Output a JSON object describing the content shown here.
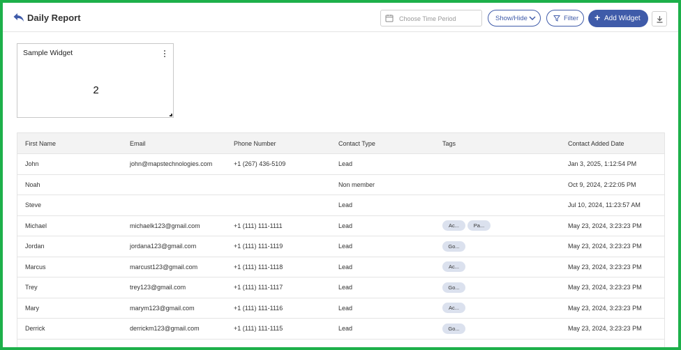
{
  "header": {
    "title": "Daily Report",
    "time_period_placeholder": "Choose Time Period",
    "show_hide_label": "Show/Hide",
    "filter_label": "Filter",
    "add_widget_label": "Add Widget"
  },
  "widget": {
    "title": "Sample Widget",
    "value": "2"
  },
  "table": {
    "columns": [
      "First Name",
      "Email",
      "Phone Number",
      "Contact Type",
      "Tags",
      "Contact Added Date"
    ],
    "rows": [
      {
        "first_name": "John",
        "email": "john@mapstechnologies.com",
        "phone": "+1 (267) 436-5109",
        "type": "Lead",
        "tags": [],
        "date": "Jan 3, 2025, 1:12:54 PM"
      },
      {
        "first_name": "Noah",
        "email": "",
        "phone": "",
        "type": "Non member",
        "tags": [],
        "date": "Oct 9, 2024, 2:22:05 PM"
      },
      {
        "first_name": "Steve",
        "email": "",
        "phone": "",
        "type": "Lead",
        "tags": [],
        "date": "Jul 10, 2024, 11:23:57 AM"
      },
      {
        "first_name": "Michael",
        "email": "michaelk123@gmail.com",
        "phone": "+1 (111) 111-1111",
        "type": "Lead",
        "tags": [
          "Ac...",
          "Pa..."
        ],
        "date": "May 23, 2024, 3:23:23 PM"
      },
      {
        "first_name": "Jordan",
        "email": "jordana123@gmail.com",
        "phone": "+1 (111) 111-1119",
        "type": "Lead",
        "tags": [
          "Go..."
        ],
        "date": "May 23, 2024, 3:23:23 PM"
      },
      {
        "first_name": "Marcus",
        "email": "marcust123@gmail.com",
        "phone": "+1 (111) 111-1118",
        "type": "Lead",
        "tags": [
          "Ac..."
        ],
        "date": "May 23, 2024, 3:23:23 PM"
      },
      {
        "first_name": "Trey",
        "email": "trey123@gmail.com",
        "phone": "+1 (111) 111-1117",
        "type": "Lead",
        "tags": [
          "Go..."
        ],
        "date": "May 23, 2024, 3:23:23 PM"
      },
      {
        "first_name": "Mary",
        "email": "marym123@gmail.com",
        "phone": "+1 (111) 111-1116",
        "type": "Lead",
        "tags": [
          "Ac..."
        ],
        "date": "May 23, 2024, 3:23:23 PM"
      },
      {
        "first_name": "Derrick",
        "email": "derrickm123@gmail.com",
        "phone": "+1 (111) 111-1115",
        "type": "Lead",
        "tags": [
          "Go..."
        ],
        "date": "May 23, 2024, 3:23:23 PM"
      }
    ]
  },
  "icons": {
    "back": "back-arrow-icon",
    "calendar": "calendar-icon",
    "chevron": "chevron-down-icon",
    "filter": "filter-icon",
    "plus": "plus-icon",
    "download": "download-icon",
    "kebab": "more-vertical-icon",
    "resize": "resize-handle-icon"
  },
  "colors": {
    "accent": "#3f5ba9",
    "frame": "#1db04a",
    "tag_bg": "#dbe1ee",
    "header_bg": "#f3f3f3"
  }
}
